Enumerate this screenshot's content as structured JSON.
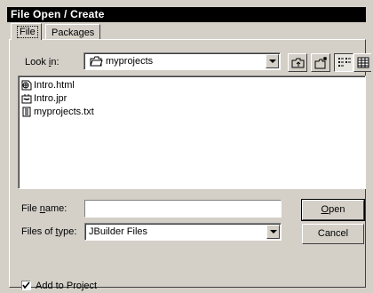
{
  "window": {
    "title": "File Open / Create"
  },
  "tabs": [
    {
      "label": "File",
      "active": true
    },
    {
      "label": "Packages",
      "active": false
    }
  ],
  "look_in": {
    "label_pre": "Look ",
    "label_accel": "i",
    "label_post": "n:",
    "value": "myprojects",
    "icon": "folder-icon"
  },
  "toolbar": [
    {
      "name": "up-folder-button",
      "icon": "up-folder-icon"
    },
    {
      "name": "new-folder-button",
      "icon": "new-folder-icon"
    },
    {
      "name": "list-view-button",
      "icon": "list-view-icon",
      "pressed": true
    },
    {
      "name": "details-view-button",
      "icon": "details-view-icon"
    }
  ],
  "files": [
    {
      "name": "Intro.html",
      "icon": "html-file-icon"
    },
    {
      "name": "Intro.jpr",
      "icon": "project-file-icon"
    },
    {
      "name": "myprojects.txt",
      "icon": "text-file-icon"
    }
  ],
  "file_name": {
    "label_pre": "File ",
    "label_accel": "n",
    "label_post": "ame:",
    "value": ""
  },
  "file_type": {
    "label_pre": "Files of ",
    "label_accel": "t",
    "label_post": "ype:",
    "value": "JBuilder Files"
  },
  "buttons": {
    "open_accel": "O",
    "open_rest": "pen",
    "cancel": "Cancel"
  },
  "add_to_project": {
    "label": "Add to Project",
    "checked": true
  }
}
